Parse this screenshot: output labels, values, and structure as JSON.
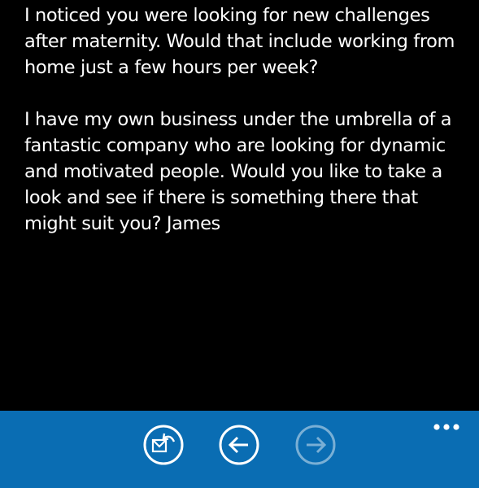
{
  "message": {
    "paragraphs": [
      "I noticed you were looking for new challenges\nafter maternity. Would that include working from\nhome just a few hours per week?",
      "I have my own business under the umbrella of a\nfantastic company who are looking for dynamic\nand motivated people. Would you like to take a\nlook and see if there is something there that\nmight suit you?   James"
    ]
  },
  "app_bar": {
    "background": "#0a6db3",
    "buttons": [
      {
        "icon": "reply-icon",
        "enabled": true
      },
      {
        "icon": "previous-arrow-icon",
        "enabled": true
      },
      {
        "icon": "next-arrow-icon",
        "enabled": false
      }
    ],
    "more_icon": "ellipsis-icon"
  }
}
